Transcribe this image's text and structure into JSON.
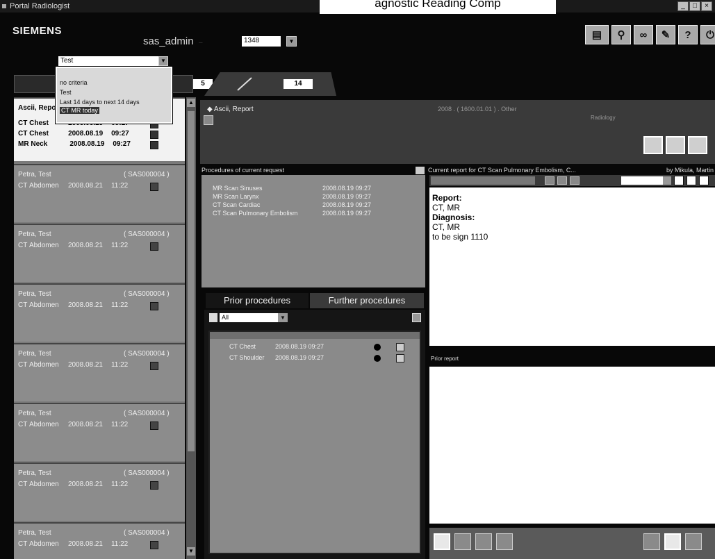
{
  "window": {
    "title": "Portal Radiologist",
    "controls": [
      "_",
      "□",
      "×"
    ]
  },
  "page_heading": "agnostic Reading Comp",
  "header": {
    "brand": "SIEMENS",
    "user": "sas_admin",
    "user_sub": "...",
    "count_value": "1348"
  },
  "toolbar": {
    "items": [
      {
        "icon": "worklist-icon",
        "label": ""
      },
      {
        "icon": "search-icon",
        "label": ""
      },
      {
        "icon": "link-icon",
        "label": ""
      },
      {
        "icon": "edit-icon",
        "label": ""
      },
      {
        "icon": "help-icon",
        "label": "?"
      },
      {
        "icon": "exit-icon",
        "label": ""
      }
    ]
  },
  "filter": {
    "label": "",
    "value": "Test",
    "right_label": "",
    "options": [
      "no criteria",
      "Test",
      "Last 14 days to next 14 days",
      "CT MR today"
    ],
    "selected_index": 3
  },
  "tabs": [
    {
      "count": "5"
    },
    {
      "count": "14"
    }
  ],
  "worklist": [
    {
      "name": "Ascii, Report",
      "id": "",
      "rows": [
        {
          "mod": "CT",
          "body": "Chest",
          "date": "2008.08.19",
          "time": "09:27"
        },
        {
          "mod": "CT",
          "body": "Chest",
          "date": "2008.08.19",
          "time": "09:27"
        },
        {
          "mod": "MR",
          "body": "Neck",
          "date": "2008.08.19",
          "time": "09:27"
        }
      ]
    },
    {
      "name": "Petra, Test",
      "id": "( SAS000004 )",
      "rows": [
        {
          "mod": "CT",
          "body": "Abdomen",
          "date": "2008.08.21",
          "time": "11:22"
        }
      ]
    },
    {
      "name": "Petra, Test",
      "id": "( SAS000004 )",
      "rows": [
        {
          "mod": "CT",
          "body": "Abdomen",
          "date": "2008.08.21",
          "time": "11:22"
        }
      ]
    },
    {
      "name": "Petra, Test",
      "id": "( SAS000004 )",
      "rows": [
        {
          "mod": "CT",
          "body": "Abdomen",
          "date": "2008.08.21",
          "time": "11:22"
        }
      ]
    },
    {
      "name": "Petra, Test",
      "id": "( SAS000004 )",
      "rows": [
        {
          "mod": "CT",
          "body": "Abdomen",
          "date": "2008.08.21",
          "time": "11:22"
        }
      ]
    },
    {
      "name": "Petra, Test",
      "id": "( SAS000004 )",
      "rows": [
        {
          "mod": "CT",
          "body": "Abdomen",
          "date": "2008.08.21",
          "time": "11:22"
        }
      ]
    },
    {
      "name": "Petra, Test",
      "id": "( SAS000004 )",
      "rows": [
        {
          "mod": "CT",
          "body": "Abdomen",
          "date": "2008.08.21",
          "time": "11:22"
        }
      ]
    },
    {
      "name": "Petra, Test",
      "id": "( SAS000004 )",
      "rows": [
        {
          "mod": "CT",
          "body": "Abdomen",
          "date": "2008.08.21",
          "time": "11:22"
        }
      ]
    }
  ],
  "patient": {
    "name": "Ascii, Report",
    "info": "2008 . ( 1600.01.01 ) . Other",
    "right": "Radiology"
  },
  "procedures": {
    "title": "Procedures of current request",
    "items": [
      {
        "name": "MR Scan Sinuses",
        "date": "2008.08.19 09:27"
      },
      {
        "name": "MR Scan Larynx",
        "date": "2008.08.19 09:27"
      },
      {
        "name": "CT Scan Cardiac",
        "date": "2008.08.19 09:27"
      },
      {
        "name": "CT Scan Pulmonary Embolism",
        "date": "2008.08.19 09:27"
      }
    ]
  },
  "prior_tabs": {
    "prior": "Prior procedures",
    "further": "Further procedures"
  },
  "prior": {
    "filter_value": "All",
    "items": [
      {
        "name": "CT Chest",
        "date": "2008.08.19 09:27"
      },
      {
        "name": "CT Shoulder",
        "date": "2008.08.19 09:27"
      }
    ]
  },
  "current_report": {
    "title": "Current report for CT Scan Pulmonary Embolism, C...",
    "by": "by Mikula, Martin",
    "lines": [
      {
        "text": "Report:",
        "bold": true
      },
      {
        "text": "CT, MR",
        "bold": false
      },
      {
        "text": "Diagnosis:",
        "bold": true
      },
      {
        "text": "CT, MR",
        "bold": false
      },
      {
        "text": "to be sign 1110",
        "bold": false
      }
    ]
  },
  "prior_report": {
    "title": "Prior report"
  },
  "colors": {
    "background": "#080808",
    "panel": "#8a8a8a",
    "selected_card": "#f2f2f2"
  }
}
